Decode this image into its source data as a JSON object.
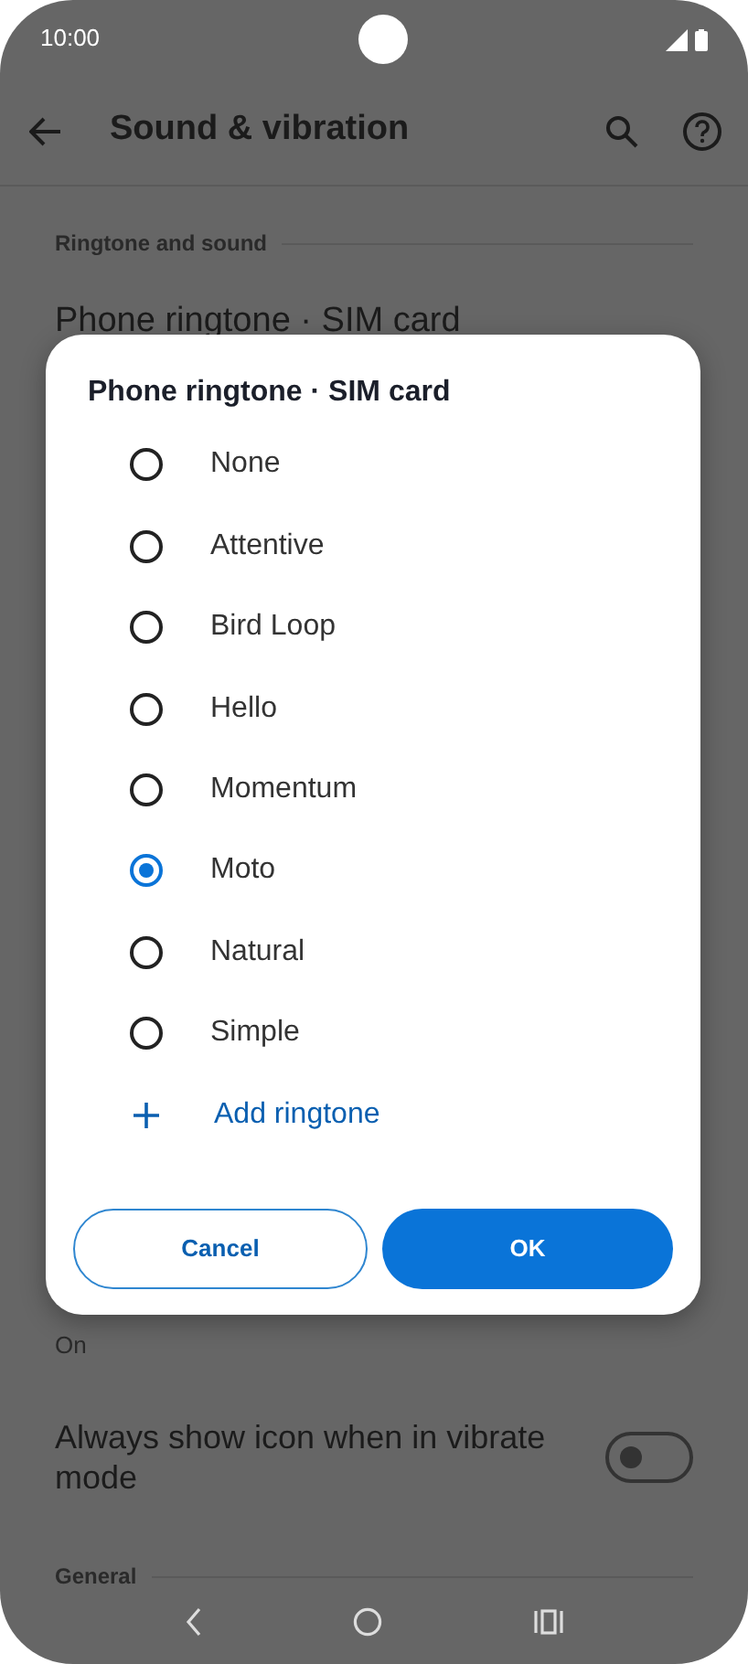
{
  "status_bar": {
    "time": "10:00"
  },
  "app_bar": {
    "title": "Sound & vibration"
  },
  "settings": [
    {
      "kind": "header",
      "text": "Ringtone and sound"
    },
    {
      "kind": "item",
      "text": "Phone ringtone · SIM card"
    },
    {
      "kind": "summary",
      "text": "On"
    },
    {
      "kind": "toggle",
      "text": "Always show icon when in vibrate mode",
      "on": false
    },
    {
      "kind": "header",
      "text": "General"
    }
  ],
  "dialog": {
    "title": "Phone ringtone · SIM card",
    "options": [
      {
        "label": "None",
        "selected": false
      },
      {
        "label": "Attentive",
        "selected": false
      },
      {
        "label": "Bird Loop",
        "selected": false
      },
      {
        "label": "Hello",
        "selected": false
      },
      {
        "label": "Momentum",
        "selected": false
      },
      {
        "label": "Moto",
        "selected": true
      },
      {
        "label": "Natural",
        "selected": false
      },
      {
        "label": "Simple",
        "selected": false
      }
    ],
    "add_action": {
      "label": "Add ringtone"
    },
    "buttons": [
      {
        "label": "Cancel",
        "kind": "outline"
      },
      {
        "label": "OK",
        "kind": "filled"
      }
    ]
  }
}
